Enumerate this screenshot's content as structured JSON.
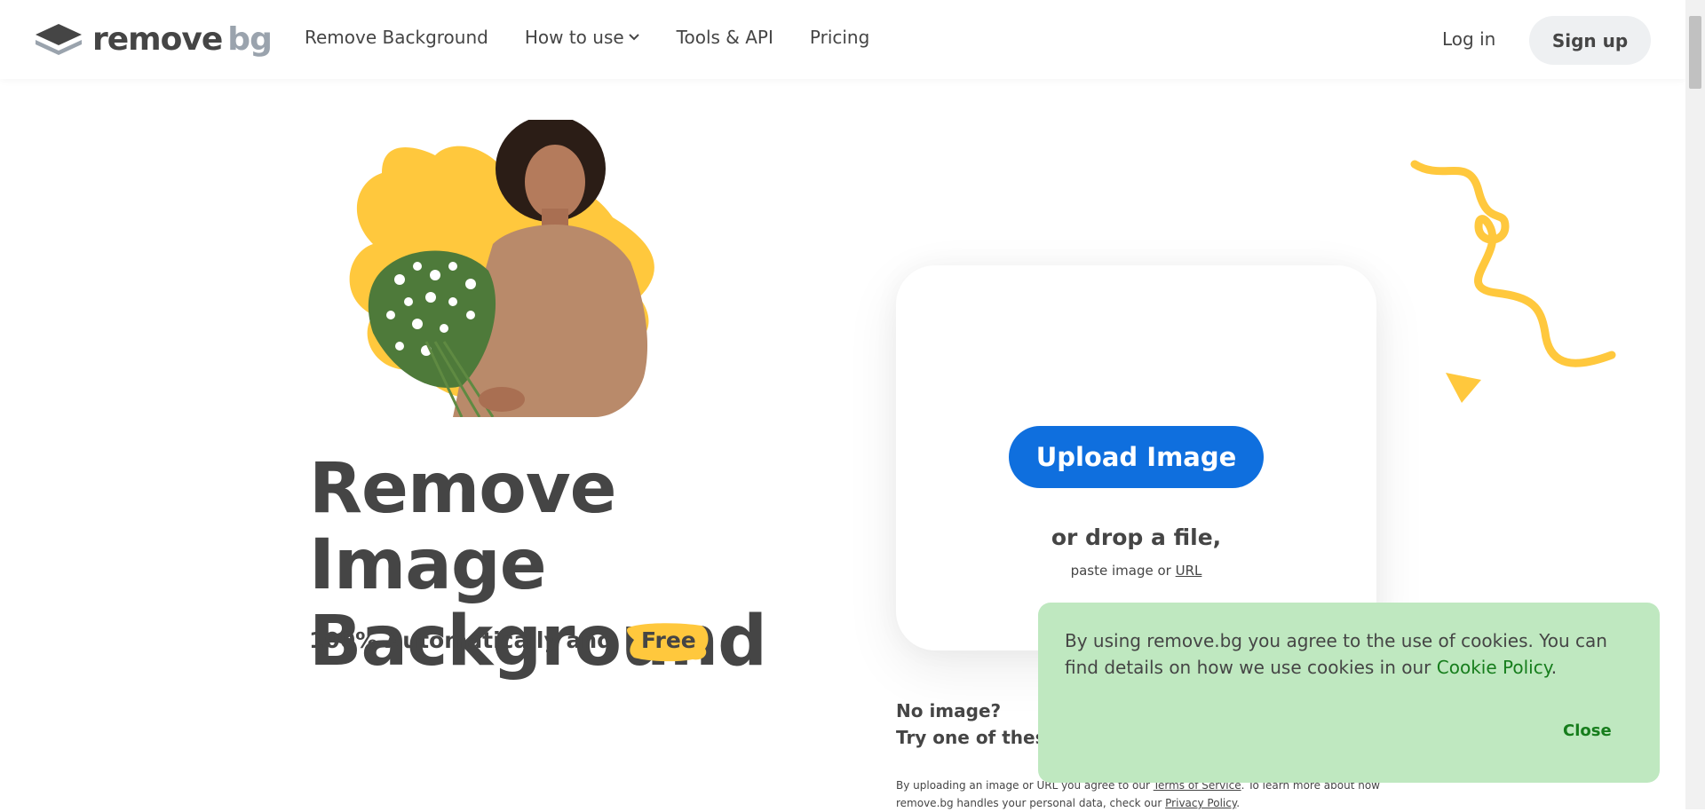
{
  "header": {
    "logo_remove": "remove",
    "logo_bg": "bg",
    "nav": [
      {
        "label": "Remove Background"
      },
      {
        "label": "How to use"
      },
      {
        "label": "Tools & API"
      },
      {
        "label": "Pricing"
      }
    ],
    "login_label": "Log in",
    "signup_label": "Sign up"
  },
  "hero": {
    "title_line1": "Remove Image",
    "title_line2": "Background",
    "subtitle": "100% Automatically and",
    "free_label": "Free"
  },
  "upload": {
    "button_label": "Upload Image",
    "drop_text": "or drop a file,",
    "paste_text": "paste image or",
    "url_label": "URL"
  },
  "samples": {
    "line1": "No image?",
    "line2": "Try one of these:"
  },
  "terms": {
    "part1": "By uploading an image or URL you agree to our",
    "tos_label": "Terms of Service",
    "part2": ". To learn more about how remove.bg handles your personal data, check our",
    "privacy_label": "Privacy Policy",
    "part3": "."
  },
  "cookie": {
    "text": "By using remove.bg you agree to the use of cookies. You can find details on how we use cookies in our",
    "link_label": "Cookie Policy",
    "period": ".",
    "close_label": "Close"
  },
  "colors": {
    "accent_blue": "#0f6fde",
    "yellow": "#ffc83d",
    "cookie_bg": "#bfe8c0",
    "cookie_link": "#167d1c",
    "text": "#454545"
  },
  "icons": {
    "logo": "stacked-layers-logo-icon",
    "nav_dropdown": "chevron-down-icon"
  }
}
